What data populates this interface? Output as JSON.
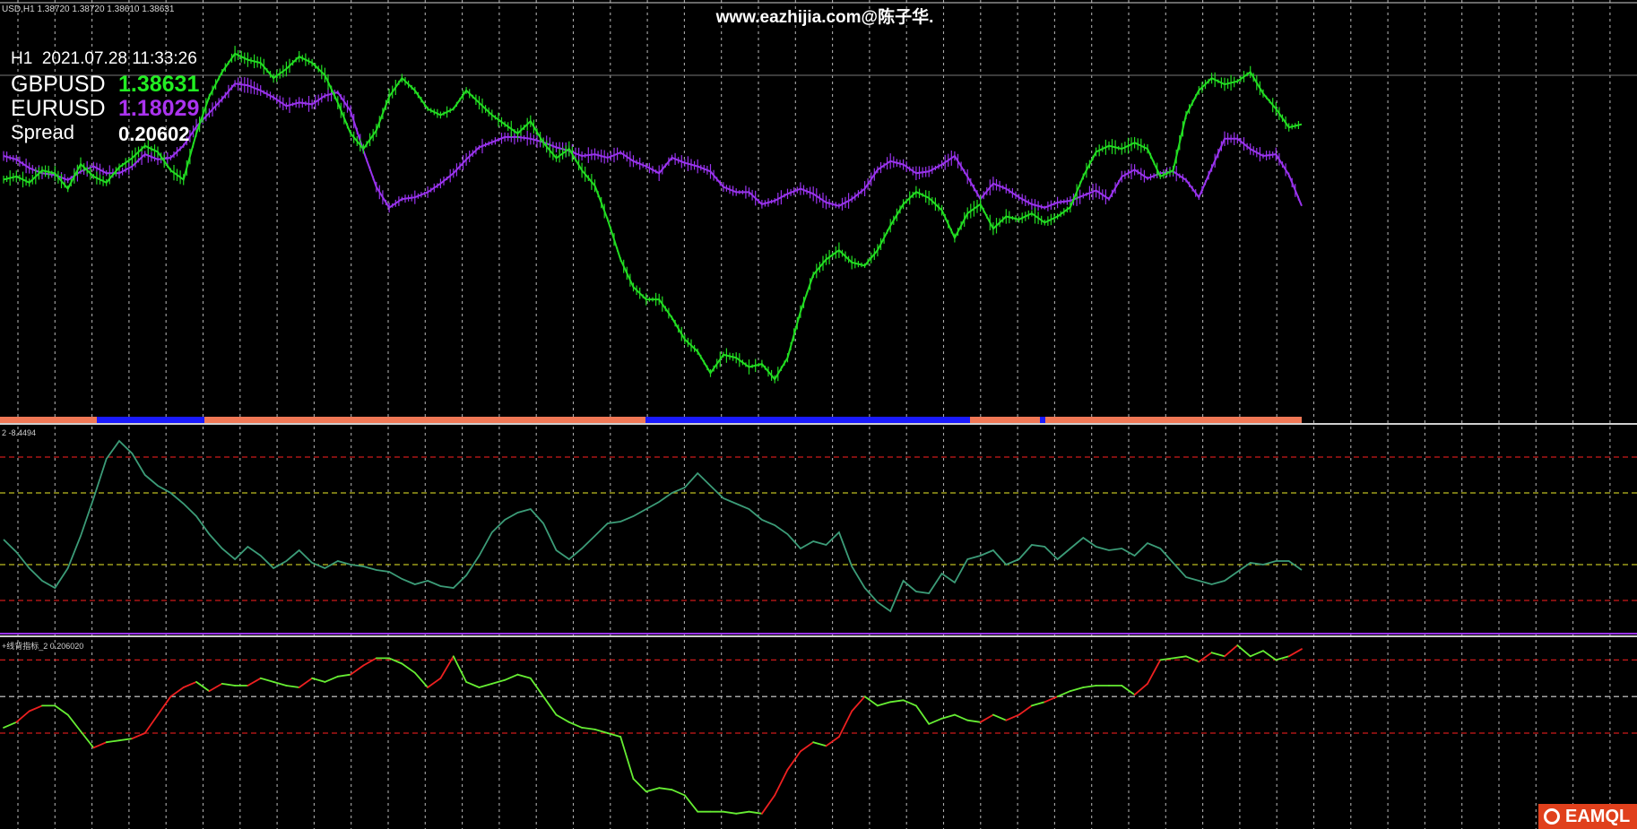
{
  "header": {
    "symbol_info": "USD,H1  1.38720 1.38720 1.38610 1.38631",
    "watermark": "www.eazhijia.com@陈子华."
  },
  "info": {
    "timeframe": "H1",
    "datetime": "2021.07.28 11:33:26",
    "pair1_name": "GBPUSD",
    "pair1_value": "1.38631",
    "pair2_name": "EURUSD",
    "pair2_value": "1.18029",
    "spread_label": "Spread",
    "spread_value": "0.20602"
  },
  "subwindows": {
    "osc_label": "2 -8.4494",
    "spread_label": "+线背指标_2 0.206020"
  },
  "logo": {
    "text": "EAMQL"
  },
  "colors": {
    "background": "#000000",
    "gbp": "#22dd22",
    "eur": "#9933ee",
    "osc_line": "#3c9c78",
    "spread_up": "#66ee33",
    "spread_down": "#ee2020",
    "bar_orange": "#f07856",
    "bar_blue": "#1a1aff",
    "grid": "#c8c8c8",
    "level_red": "#cc1a1a",
    "level_yellow": "#bcbc20",
    "separator": "#cfcfcf",
    "value_gbp": "#22ee22",
    "value_eur": "#aa33ee",
    "logo_bg": "#e0401c"
  },
  "chart_data": [
    {
      "type": "line",
      "title": "",
      "series": [
        {
          "name": "GBPUSD",
          "values": [
            1.3845,
            1.3846,
            1.3844,
            1.3848,
            1.3847,
            1.3842,
            1.385,
            1.3846,
            1.3844,
            1.3849,
            1.3852,
            1.3856,
            1.3854,
            1.3848,
            1.3845,
            1.386,
            1.3872,
            1.388,
            1.3886,
            1.3884,
            1.3883,
            1.3878,
            1.3881,
            1.3885,
            1.3883,
            1.3879,
            1.387,
            1.386,
            1.3855,
            1.3861,
            1.3872,
            1.3878,
            1.3874,
            1.3868,
            1.3866,
            1.3868,
            1.3874,
            1.387,
            1.3866,
            1.3863,
            1.386,
            1.3864,
            1.3857,
            1.3852,
            1.3855,
            1.3848,
            1.3843,
            1.3832,
            1.3819,
            1.381,
            1.3806,
            1.3806,
            1.38,
            1.3793,
            1.3789,
            1.3782,
            1.3788,
            1.3787,
            1.3784,
            1.3785,
            1.378,
            1.3787,
            1.3802,
            1.3814,
            1.3819,
            1.3822,
            1.3818,
            1.3817,
            1.3822,
            1.383,
            1.3837,
            1.3841,
            1.3839,
            1.3835,
            1.3826,
            1.3834,
            1.3837,
            1.3829,
            1.3833,
            1.3832,
            1.3834,
            1.3831,
            1.3833,
            1.3836,
            1.3846,
            1.3854,
            1.3856,
            1.3855,
            1.3857,
            1.3855,
            1.3846,
            1.3848,
            1.3866,
            1.3874,
            1.3878,
            1.3876,
            1.3877,
            1.388,
            1.3873,
            1.3868,
            1.3862,
            1.3863
          ]
        },
        {
          "name": "EURUSD",
          "values": [
            1.1832,
            1.183,
            1.1825,
            1.1822,
            1.1821,
            1.1818,
            1.1823,
            1.1826,
            1.1822,
            1.1822,
            1.1826,
            1.1833,
            1.183,
            1.1831,
            1.1838,
            1.1849,
            1.1857,
            1.1865,
            1.1874,
            1.1873,
            1.187,
            1.1866,
            1.1861,
            1.1863,
            1.1862,
            1.1867,
            1.1869,
            1.1858,
            1.1835,
            1.1814,
            1.1802,
            1.1807,
            1.1808,
            1.1811,
            1.1816,
            1.1822,
            1.183,
            1.1837,
            1.184,
            1.1843,
            1.1843,
            1.1842,
            1.184,
            1.1837,
            1.1835,
            1.1832,
            1.1833,
            1.1831,
            1.1834,
            1.1829,
            1.1826,
            1.1822,
            1.1831,
            1.1828,
            1.1826,
            1.1823,
            1.1814,
            1.1811,
            1.1811,
            1.1804,
            1.1806,
            1.181,
            1.1813,
            1.181,
            1.1805,
            1.1803,
            1.1807,
            1.1813,
            1.1824,
            1.1829,
            1.1827,
            1.1822,
            1.1823,
            1.1827,
            1.1832,
            1.182,
            1.1807,
            1.1816,
            1.1813,
            1.1808,
            1.1804,
            1.1802,
            1.1805,
            1.1806,
            1.1809,
            1.1812,
            1.1807,
            1.182,
            1.1824,
            1.1819,
            1.1822,
            1.1823,
            1.1818,
            1.1808,
            1.1825,
            1.1842,
            1.1842,
            1.1836,
            1.1832,
            1.1833,
            1.1821,
            1.1803
          ]
        }
      ],
      "legend": "top-left",
      "grid": true
    },
    {
      "type": "line",
      "title": "",
      "series": [
        {
          "name": "",
          "values": [
            -12,
            -26,
            -44,
            -58,
            -66,
            -44,
            -8,
            34,
            78,
            98,
            84,
            60,
            48,
            40,
            28,
            14,
            -6,
            -22,
            -34,
            -20,
            -30,
            -44,
            -36,
            -24,
            -38,
            -44,
            -36,
            -40,
            -42,
            -46,
            -48,
            -56,
            -62,
            -58,
            -64,
            -66,
            -52,
            -30,
            -4,
            10,
            18,
            22,
            6,
            -24,
            -34,
            -22,
            -8,
            6,
            8,
            14,
            22,
            30,
            40,
            46,
            62,
            48,
            34,
            28,
            22,
            10,
            4,
            -6,
            -22,
            -14,
            -18,
            -4,
            -42,
            -66,
            -82,
            -92,
            -58,
            -70,
            -72,
            -50,
            -60,
            -34,
            -30,
            -24,
            -40,
            -34,
            -18,
            -20,
            -34,
            -22,
            -10,
            -20,
            -24,
            -22,
            -30,
            -16,
            -22,
            -38,
            -54,
            -58,
            -62,
            -58,
            -48,
            -38,
            -40,
            -36,
            -36,
            -46
          ]
        }
      ],
      "levels": [
        80,
        40,
        -40,
        -80
      ],
      "grid": true
    },
    {
      "type": "line",
      "title": "",
      "series": [
        {
          "name": "",
          "values": [
            0.2013,
            0.2016,
            0.2022,
            0.2025,
            0.2025,
            0.202,
            0.2011,
            0.2002,
            0.2005,
            0.2006,
            0.2007,
            0.201,
            0.202,
            0.203,
            0.2035,
            0.2038,
            0.2033,
            0.2037,
            0.2036,
            0.2036,
            0.204,
            0.2038,
            0.2036,
            0.2035,
            0.204,
            0.2038,
            0.2041,
            0.2042,
            0.2047,
            0.2051,
            0.2051,
            0.2048,
            0.2043,
            0.2035,
            0.204,
            0.2052,
            0.2038,
            0.2035,
            0.2037,
            0.2039,
            0.2042,
            0.204,
            0.203,
            0.202,
            0.2016,
            0.2013,
            0.2012,
            0.201,
            0.2008,
            0.1985,
            0.1978,
            0.198,
            0.1979,
            0.1976,
            0.1967,
            0.1967,
            0.1967,
            0.1966,
            0.1967,
            0.1966,
            0.1976,
            0.199,
            0.2,
            0.2005,
            0.2003,
            0.2008,
            0.2022,
            0.203,
            0.2025,
            0.2027,
            0.2028,
            0.2025,
            0.2015,
            0.2018,
            0.202,
            0.2017,
            0.2016,
            0.202,
            0.2017,
            0.202,
            0.2025,
            0.2027,
            0.203,
            0.2033,
            0.2035,
            0.2036,
            0.2036,
            0.2036,
            0.2031,
            0.2037,
            0.205,
            0.2051,
            0.2052,
            0.2049,
            0.2054,
            0.2052,
            0.2058,
            0.2052,
            0.2055,
            0.205,
            0.2052,
            0.2056
          ]
        }
      ],
      "levels": [
        0.205,
        0.203,
        0.201
      ],
      "grid": true
    }
  ]
}
